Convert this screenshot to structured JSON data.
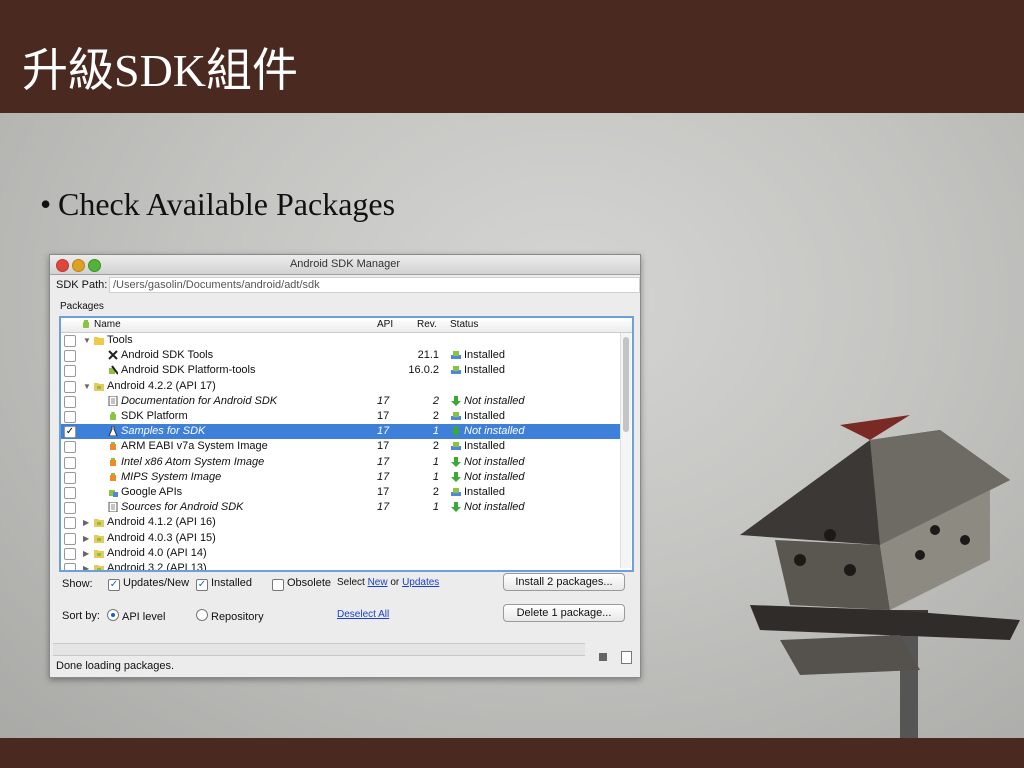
{
  "slide": {
    "title": "升級SDK組件",
    "bullet": "Check Available Packages"
  },
  "window": {
    "title": "Android SDK Manager",
    "sdk_path_label": "SDK Path:",
    "sdk_path_value": "/Users/gasolin/Documents/android/adt/sdk",
    "packages_label": "Packages",
    "columns": {
      "name": "Name",
      "api": "API",
      "rev": "Rev.",
      "status": "Status"
    },
    "rows": [
      {
        "indent": 1,
        "expand": "open",
        "checked": false,
        "name": "Tools",
        "api": "",
        "rev": "",
        "status": "",
        "italic": false,
        "icon": "folder-icon"
      },
      {
        "indent": 2,
        "checked": false,
        "name": "Android SDK Tools",
        "api": "",
        "rev": "21.1",
        "status": "Installed",
        "italic": false,
        "icon": "tools-icon"
      },
      {
        "indent": 2,
        "checked": false,
        "name": "Android SDK Platform-tools",
        "api": "",
        "rev": "16.0.2",
        "status": "Installed",
        "italic": false,
        "icon": "platform-tools-icon"
      },
      {
        "indent": 1,
        "expand": "open",
        "checked": false,
        "name": "Android 4.2.2 (API 17)",
        "api": "",
        "rev": "",
        "status": "",
        "italic": false,
        "icon": "package-folder-icon"
      },
      {
        "indent": 2,
        "checked": false,
        "name": "Documentation for Android SDK",
        "api": "17",
        "rev": "2",
        "status": "Not installed",
        "italic": true,
        "icon": "document-icon"
      },
      {
        "indent": 2,
        "checked": false,
        "name": "SDK Platform",
        "api": "17",
        "rev": "2",
        "status": "Installed",
        "italic": false,
        "icon": "android-icon"
      },
      {
        "indent": 2,
        "checked": true,
        "selected": true,
        "name": "Samples for SDK",
        "api": "17",
        "rev": "1",
        "status": "Not installed",
        "italic": true,
        "icon": "flask-icon"
      },
      {
        "indent": 2,
        "checked": false,
        "name": "ARM EABI v7a System Image",
        "api": "17",
        "rev": "2",
        "status": "Installed",
        "italic": false,
        "icon": "system-image-icon"
      },
      {
        "indent": 2,
        "checked": false,
        "name": "Intel x86 Atom System Image",
        "api": "17",
        "rev": "1",
        "status": "Not installed",
        "italic": true,
        "icon": "system-image-icon"
      },
      {
        "indent": 2,
        "checked": false,
        "name": "MIPS System Image",
        "api": "17",
        "rev": "1",
        "status": "Not installed",
        "italic": true,
        "icon": "system-image-icon"
      },
      {
        "indent": 2,
        "checked": false,
        "name": "Google APIs",
        "api": "17",
        "rev": "2",
        "status": "Installed",
        "italic": false,
        "icon": "google-apis-icon"
      },
      {
        "indent": 2,
        "checked": false,
        "name": "Sources for Android SDK",
        "api": "17",
        "rev": "1",
        "status": "Not installed",
        "italic": true,
        "icon": "document-icon"
      },
      {
        "indent": 1,
        "expand": "closed",
        "checked": false,
        "name": "Android 4.1.2 (API 16)",
        "api": "",
        "rev": "",
        "status": "",
        "italic": false,
        "icon": "package-folder-icon"
      },
      {
        "indent": 1,
        "expand": "closed",
        "checked": false,
        "name": "Android 4.0.3 (API 15)",
        "api": "",
        "rev": "",
        "status": "",
        "italic": false,
        "icon": "package-folder-icon"
      },
      {
        "indent": 1,
        "expand": "closed",
        "checked": false,
        "name": "Android 4.0 (API 14)",
        "api": "",
        "rev": "",
        "status": "",
        "italic": false,
        "icon": "package-folder-icon"
      },
      {
        "indent": 1,
        "expand": "closed",
        "checked": false,
        "name": "Android 3.2 (API 13)",
        "api": "",
        "rev": "",
        "status": "",
        "italic": false,
        "icon": "package-folder-icon"
      }
    ],
    "show_label": "Show:",
    "updates_new_label": "Updates/New",
    "installed_label": "Installed",
    "obsolete_label": "Obsolete",
    "select_prefix": "Select",
    "select_new": "New",
    "select_or": "or",
    "select_updates": "Updates",
    "install_button": "Install 2 packages...",
    "sort_label": "Sort by:",
    "api_level_label": "API level",
    "repository_label": "Repository",
    "deselect_all": "Deselect All",
    "delete_button": "Delete 1 package...",
    "status_text": "Done loading packages.",
    "colors": {
      "selection": "#3d7fd9",
      "title_bar": "#4a2a20"
    }
  }
}
